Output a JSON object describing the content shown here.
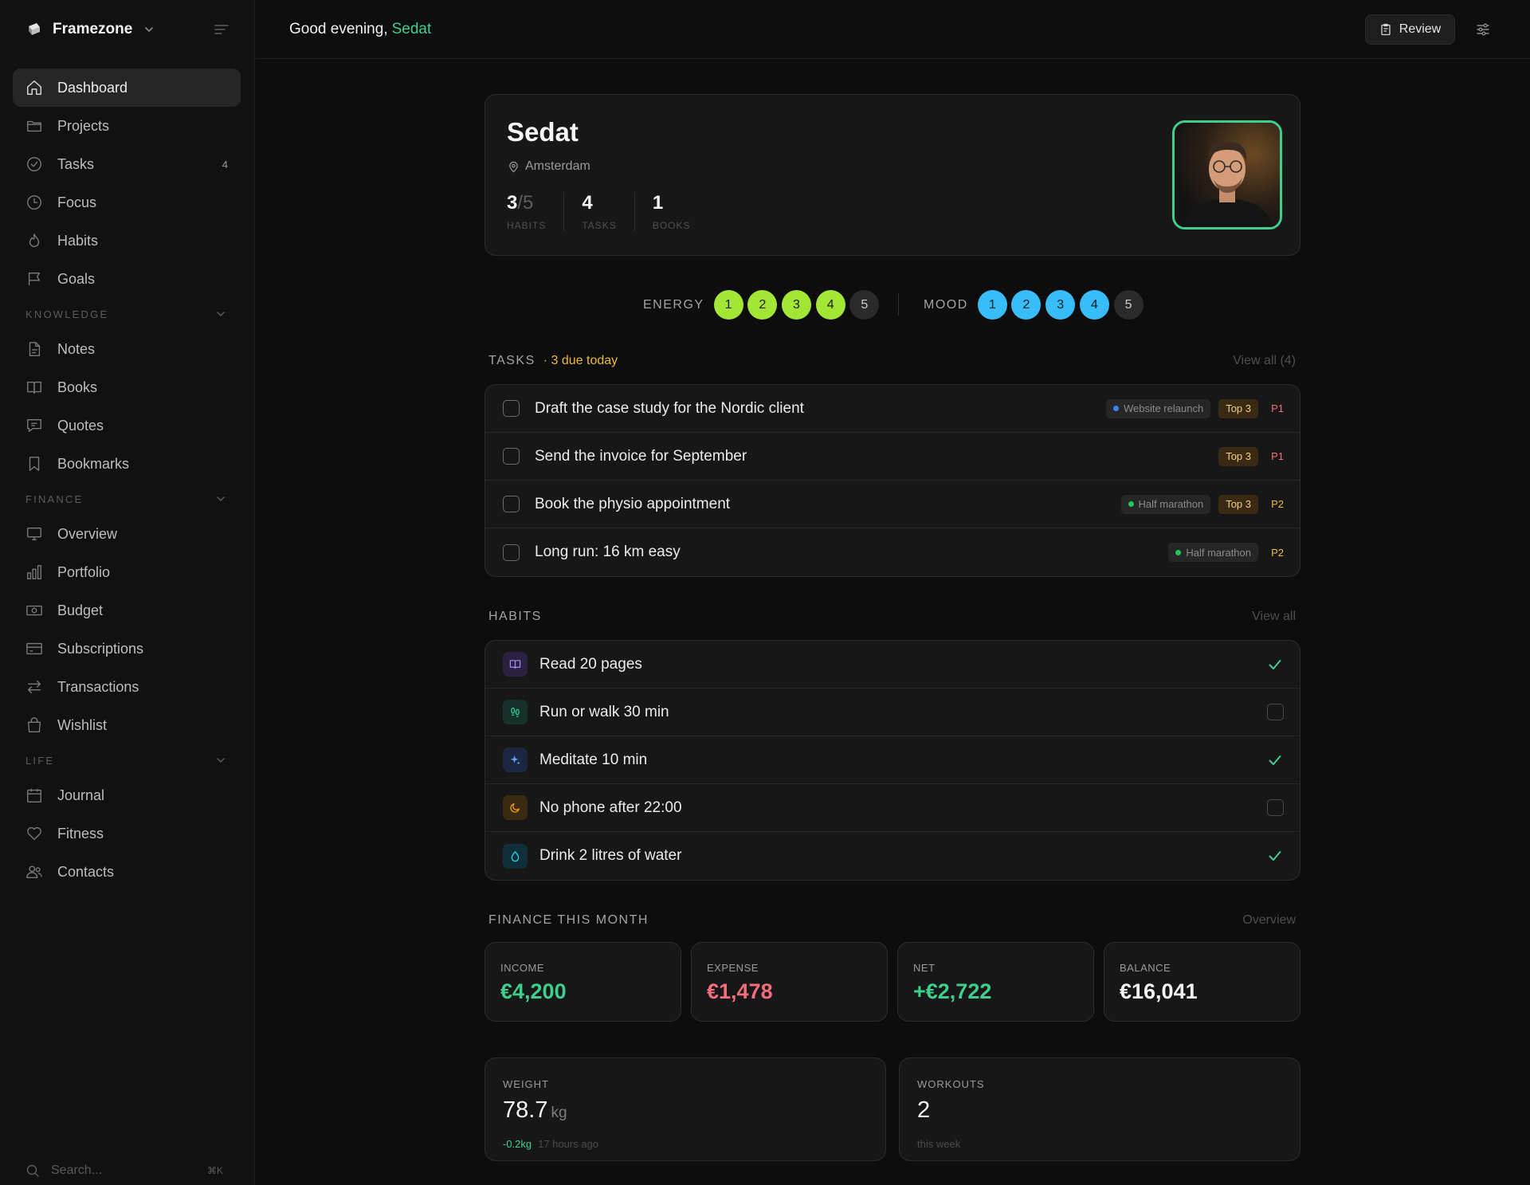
{
  "app": {
    "name": "Framezone"
  },
  "sidebar": {
    "main_items": [
      {
        "label": "Dashboard",
        "icon": "home-icon"
      },
      {
        "label": "Projects",
        "icon": "folder-icon"
      },
      {
        "label": "Tasks",
        "icon": "check-circle-icon",
        "count": "4"
      },
      {
        "label": "Focus",
        "icon": "clock-icon"
      },
      {
        "label": "Habits",
        "icon": "flame-icon"
      },
      {
        "label": "Goals",
        "icon": "flag-icon"
      }
    ],
    "knowledge": {
      "title": "KNOWLEDGE",
      "items": [
        {
          "label": "Notes",
          "icon": "note-icon"
        },
        {
          "label": "Books",
          "icon": "book-icon"
        },
        {
          "label": "Quotes",
          "icon": "quote-icon"
        },
        {
          "label": "Bookmarks",
          "icon": "bookmark-icon"
        }
      ]
    },
    "finance": {
      "title": "FINANCE",
      "items": [
        {
          "label": "Overview",
          "icon": "monitor-icon"
        },
        {
          "label": "Portfolio",
          "icon": "bar-chart-icon"
        },
        {
          "label": "Budget",
          "icon": "banknote-icon"
        },
        {
          "label": "Subscriptions",
          "icon": "credit-card-icon"
        },
        {
          "label": "Transactions",
          "icon": "arrows-icon"
        },
        {
          "label": "Wishlist",
          "icon": "shopping-bag-icon"
        }
      ]
    },
    "life": {
      "title": "LIFE",
      "items": [
        {
          "label": "Journal",
          "icon": "calendar-icon"
        },
        {
          "label": "Fitness",
          "icon": "heart-icon"
        },
        {
          "label": "Contacts",
          "icon": "users-icon"
        }
      ]
    },
    "search": {
      "placeholder": "Search...",
      "shortcut": "⌘K"
    }
  },
  "topbar": {
    "greeting": "Good evening,",
    "user_name": "Sedat",
    "review_label": "Review"
  },
  "profile": {
    "name": "Sedat",
    "location": "Amsterdam",
    "stats": [
      {
        "value": "3",
        "total": "/5",
        "label": "HABITS"
      },
      {
        "value": "4",
        "total": "",
        "label": "TASKS"
      },
      {
        "value": "1",
        "total": "",
        "label": "BOOKS"
      }
    ]
  },
  "energy": {
    "label": "ENERGY",
    "options": [
      "1",
      "2",
      "3",
      "4",
      "5"
    ],
    "value": 4,
    "color": "#a3e635"
  },
  "mood": {
    "label": "MOOD",
    "options": [
      "1",
      "2",
      "3",
      "4",
      "5"
    ],
    "value": 4,
    "color": "#38bdf8"
  },
  "tasks": {
    "title": "TASKS",
    "due": "· 3 due today",
    "view_all": "View all (4)",
    "items": [
      {
        "title": "Draft the case study for the Nordic client",
        "project": "Website relaunch",
        "project_color": "#3b82f6",
        "top": "Top 3",
        "priority": "P1",
        "priority_color": "#f26d7d"
      },
      {
        "title": "Send the invoice for September",
        "project": "",
        "project_color": "",
        "top": "Top 3",
        "priority": "P1",
        "priority_color": "#f26d7d"
      },
      {
        "title": "Book the physio appointment",
        "project": "Half marathon",
        "project_color": "#22c55e",
        "top": "Top 3",
        "priority": "P2",
        "priority_color": "#f0b93a"
      },
      {
        "title": "Long run: 16 km easy",
        "project": "Half marathon",
        "project_color": "#22c55e",
        "top": "",
        "priority": "P2",
        "priority_color": "#f0b93a"
      }
    ]
  },
  "habits": {
    "title": "HABITS",
    "view_all": "View all",
    "items": [
      {
        "title": "Read 20 pages",
        "icon": "book-open-icon",
        "color": "#a78bfa",
        "bg": "#2a2140",
        "done": true
      },
      {
        "title": "Run or walk 30 min",
        "icon": "footprints-icon",
        "color": "#34d399",
        "bg": "#16302a",
        "done": false
      },
      {
        "title": "Meditate 10 min",
        "icon": "sparkles-icon",
        "color": "#60a5fa",
        "bg": "#1b2640",
        "done": true
      },
      {
        "title": "No phone after 22:00",
        "icon": "moon-icon",
        "color": "#f59e0b",
        "bg": "#3a2a12",
        "done": false
      },
      {
        "title": "Drink 2 litres of water",
        "icon": "droplet-icon",
        "color": "#22d3ee",
        "bg": "#112f38",
        "done": true
      }
    ]
  },
  "finance": {
    "title": "FINANCE THIS MONTH",
    "link": "Overview",
    "cards": [
      {
        "label": "INCOME",
        "value": "€4,200",
        "color": "#3ecf8e"
      },
      {
        "label": "EXPENSE",
        "value": "€1,478",
        "color": "#f26d7d"
      },
      {
        "label": "NET",
        "value": "+€2,722",
        "color": "#3ecf8e"
      },
      {
        "label": "BALANCE",
        "value": "€16,041",
        "color": "#f3f3f3"
      }
    ]
  },
  "fitness": {
    "weight": {
      "label": "WEIGHT",
      "value": "78.7",
      "unit": "kg",
      "delta": "-0.2kg",
      "time": "17 hours ago"
    },
    "workouts": {
      "label": "WORKOUTS",
      "value": "2",
      "sub": "this week"
    }
  },
  "colors": {
    "accent": "#3ecf8e",
    "background": "#0d0d0d",
    "card": "#171717"
  }
}
